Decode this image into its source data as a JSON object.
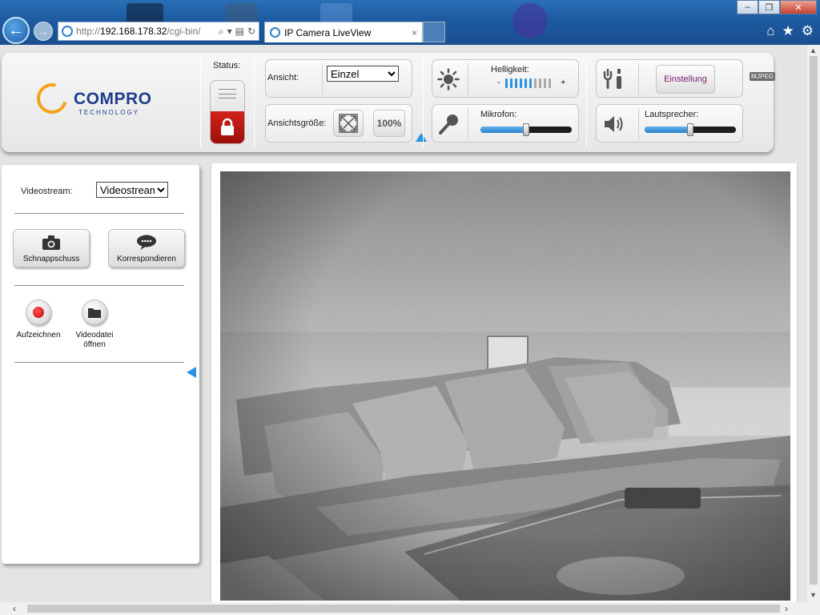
{
  "browser": {
    "url_grey": "http://",
    "url_host": "192.168.178.32",
    "url_path": "/cgi-bin/",
    "tab_title": "IP Camera LiveView",
    "tab_close": "×",
    "window": {
      "minimize": "–",
      "restore": "❐",
      "close": "✕"
    },
    "toolbar_icons": {
      "home": "⌂",
      "favorites": "★",
      "settings": "⚙"
    }
  },
  "header": {
    "logo_word": "COMPRO",
    "logo_sub": "TECHNOLOGY",
    "status_label": "Status:",
    "view_label": "Ansicht:",
    "view_value": "Einzel",
    "view_options": [
      "Einzel"
    ],
    "size_label": "Ansichtsgröße:",
    "zoom_label": "100%",
    "brightness_label": "Helligkeit:",
    "brightness_minus": "-",
    "brightness_plus": "+",
    "brightness_level": 0.6,
    "mic_label": "Mikrofon:",
    "mic_level": 0.5,
    "settings_label": "Einstellung",
    "speaker_label": "Lautsprecher:",
    "speaker_level": 0.5,
    "codec_badge": "MJPEG",
    "colors": {
      "accent": "#2b94e0",
      "lock": "#c41a15",
      "settings_text": "#7a1f6f"
    }
  },
  "sidebar": {
    "stream_label": "Videostream:",
    "stream_value": "Videostream",
    "stream_options": [
      "Videostream"
    ],
    "snapshot_label": "Schnappschuss",
    "correspond_label": "Korrespondieren",
    "record_label": "Aufzeichnen",
    "open_label_line1": "Videodatei",
    "open_label_line2": "öffnen"
  }
}
